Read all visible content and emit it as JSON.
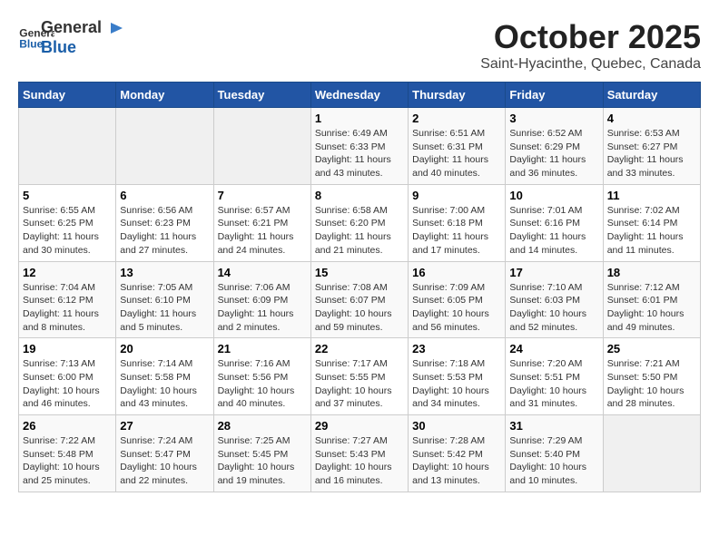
{
  "header": {
    "logo_general": "General",
    "logo_blue": "Blue",
    "month_title": "October 2025",
    "location": "Saint-Hyacinthe, Quebec, Canada"
  },
  "weekdays": [
    "Sunday",
    "Monday",
    "Tuesday",
    "Wednesday",
    "Thursday",
    "Friday",
    "Saturday"
  ],
  "weeks": [
    [
      {
        "day": "",
        "sunrise": "",
        "sunset": "",
        "daylight": ""
      },
      {
        "day": "",
        "sunrise": "",
        "sunset": "",
        "daylight": ""
      },
      {
        "day": "",
        "sunrise": "",
        "sunset": "",
        "daylight": ""
      },
      {
        "day": "1",
        "sunrise": "Sunrise: 6:49 AM",
        "sunset": "Sunset: 6:33 PM",
        "daylight": "Daylight: 11 hours and 43 minutes."
      },
      {
        "day": "2",
        "sunrise": "Sunrise: 6:51 AM",
        "sunset": "Sunset: 6:31 PM",
        "daylight": "Daylight: 11 hours and 40 minutes."
      },
      {
        "day": "3",
        "sunrise": "Sunrise: 6:52 AM",
        "sunset": "Sunset: 6:29 PM",
        "daylight": "Daylight: 11 hours and 36 minutes."
      },
      {
        "day": "4",
        "sunrise": "Sunrise: 6:53 AM",
        "sunset": "Sunset: 6:27 PM",
        "daylight": "Daylight: 11 hours and 33 minutes."
      }
    ],
    [
      {
        "day": "5",
        "sunrise": "Sunrise: 6:55 AM",
        "sunset": "Sunset: 6:25 PM",
        "daylight": "Daylight: 11 hours and 30 minutes."
      },
      {
        "day": "6",
        "sunrise": "Sunrise: 6:56 AM",
        "sunset": "Sunset: 6:23 PM",
        "daylight": "Daylight: 11 hours and 27 minutes."
      },
      {
        "day": "7",
        "sunrise": "Sunrise: 6:57 AM",
        "sunset": "Sunset: 6:21 PM",
        "daylight": "Daylight: 11 hours and 24 minutes."
      },
      {
        "day": "8",
        "sunrise": "Sunrise: 6:58 AM",
        "sunset": "Sunset: 6:20 PM",
        "daylight": "Daylight: 11 hours and 21 minutes."
      },
      {
        "day": "9",
        "sunrise": "Sunrise: 7:00 AM",
        "sunset": "Sunset: 6:18 PM",
        "daylight": "Daylight: 11 hours and 17 minutes."
      },
      {
        "day": "10",
        "sunrise": "Sunrise: 7:01 AM",
        "sunset": "Sunset: 6:16 PM",
        "daylight": "Daylight: 11 hours and 14 minutes."
      },
      {
        "day": "11",
        "sunrise": "Sunrise: 7:02 AM",
        "sunset": "Sunset: 6:14 PM",
        "daylight": "Daylight: 11 hours and 11 minutes."
      }
    ],
    [
      {
        "day": "12",
        "sunrise": "Sunrise: 7:04 AM",
        "sunset": "Sunset: 6:12 PM",
        "daylight": "Daylight: 11 hours and 8 minutes."
      },
      {
        "day": "13",
        "sunrise": "Sunrise: 7:05 AM",
        "sunset": "Sunset: 6:10 PM",
        "daylight": "Daylight: 11 hours and 5 minutes."
      },
      {
        "day": "14",
        "sunrise": "Sunrise: 7:06 AM",
        "sunset": "Sunset: 6:09 PM",
        "daylight": "Daylight: 11 hours and 2 minutes."
      },
      {
        "day": "15",
        "sunrise": "Sunrise: 7:08 AM",
        "sunset": "Sunset: 6:07 PM",
        "daylight": "Daylight: 10 hours and 59 minutes."
      },
      {
        "day": "16",
        "sunrise": "Sunrise: 7:09 AM",
        "sunset": "Sunset: 6:05 PM",
        "daylight": "Daylight: 10 hours and 56 minutes."
      },
      {
        "day": "17",
        "sunrise": "Sunrise: 7:10 AM",
        "sunset": "Sunset: 6:03 PM",
        "daylight": "Daylight: 10 hours and 52 minutes."
      },
      {
        "day": "18",
        "sunrise": "Sunrise: 7:12 AM",
        "sunset": "Sunset: 6:01 PM",
        "daylight": "Daylight: 10 hours and 49 minutes."
      }
    ],
    [
      {
        "day": "19",
        "sunrise": "Sunrise: 7:13 AM",
        "sunset": "Sunset: 6:00 PM",
        "daylight": "Daylight: 10 hours and 46 minutes."
      },
      {
        "day": "20",
        "sunrise": "Sunrise: 7:14 AM",
        "sunset": "Sunset: 5:58 PM",
        "daylight": "Daylight: 10 hours and 43 minutes."
      },
      {
        "day": "21",
        "sunrise": "Sunrise: 7:16 AM",
        "sunset": "Sunset: 5:56 PM",
        "daylight": "Daylight: 10 hours and 40 minutes."
      },
      {
        "day": "22",
        "sunrise": "Sunrise: 7:17 AM",
        "sunset": "Sunset: 5:55 PM",
        "daylight": "Daylight: 10 hours and 37 minutes."
      },
      {
        "day": "23",
        "sunrise": "Sunrise: 7:18 AM",
        "sunset": "Sunset: 5:53 PM",
        "daylight": "Daylight: 10 hours and 34 minutes."
      },
      {
        "day": "24",
        "sunrise": "Sunrise: 7:20 AM",
        "sunset": "Sunset: 5:51 PM",
        "daylight": "Daylight: 10 hours and 31 minutes."
      },
      {
        "day": "25",
        "sunrise": "Sunrise: 7:21 AM",
        "sunset": "Sunset: 5:50 PM",
        "daylight": "Daylight: 10 hours and 28 minutes."
      }
    ],
    [
      {
        "day": "26",
        "sunrise": "Sunrise: 7:22 AM",
        "sunset": "Sunset: 5:48 PM",
        "daylight": "Daylight: 10 hours and 25 minutes."
      },
      {
        "day": "27",
        "sunrise": "Sunrise: 7:24 AM",
        "sunset": "Sunset: 5:47 PM",
        "daylight": "Daylight: 10 hours and 22 minutes."
      },
      {
        "day": "28",
        "sunrise": "Sunrise: 7:25 AM",
        "sunset": "Sunset: 5:45 PM",
        "daylight": "Daylight: 10 hours and 19 minutes."
      },
      {
        "day": "29",
        "sunrise": "Sunrise: 7:27 AM",
        "sunset": "Sunset: 5:43 PM",
        "daylight": "Daylight: 10 hours and 16 minutes."
      },
      {
        "day": "30",
        "sunrise": "Sunrise: 7:28 AM",
        "sunset": "Sunset: 5:42 PM",
        "daylight": "Daylight: 10 hours and 13 minutes."
      },
      {
        "day": "31",
        "sunrise": "Sunrise: 7:29 AM",
        "sunset": "Sunset: 5:40 PM",
        "daylight": "Daylight: 10 hours and 10 minutes."
      },
      {
        "day": "",
        "sunrise": "",
        "sunset": "",
        "daylight": ""
      }
    ]
  ]
}
